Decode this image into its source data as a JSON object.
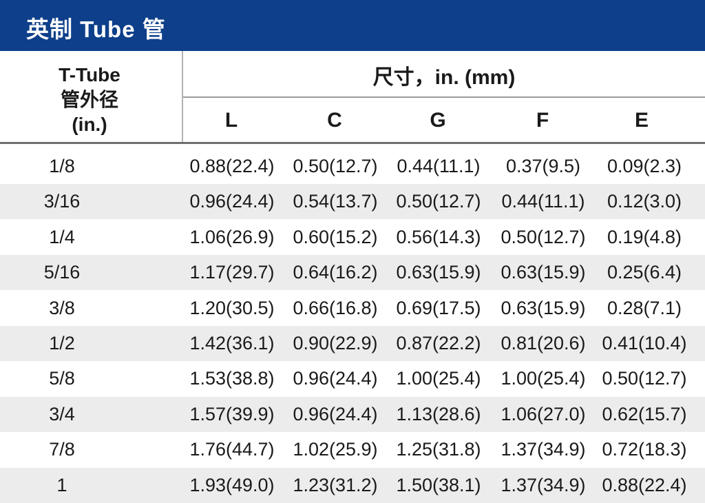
{
  "title": "英制 Tube 管",
  "header": {
    "tube_line1": "T-Tube",
    "tube_line2": "管外径",
    "tube_line3": "(in.)",
    "dimensions": "尺寸，in. (mm)"
  },
  "columns": [
    "L",
    "C",
    "G",
    "F",
    "E"
  ],
  "rows": [
    {
      "size": "1/8",
      "values": [
        "0.88(22.4)",
        "0.50(12.7)",
        "0.44(11.1)",
        "0.37(9.5)",
        "0.09(2.3)"
      ]
    },
    {
      "size": "3/16",
      "values": [
        "0.96(24.4)",
        "0.54(13.7)",
        "0.50(12.7)",
        "0.44(11.1)",
        "0.12(3.0)"
      ]
    },
    {
      "size": "1/4",
      "values": [
        "1.06(26.9)",
        "0.60(15.2)",
        "0.56(14.3)",
        "0.50(12.7)",
        "0.19(4.8)"
      ]
    },
    {
      "size": "5/16",
      "values": [
        "1.17(29.7)",
        "0.64(16.2)",
        "0.63(15.9)",
        "0.63(15.9)",
        "0.25(6.4)"
      ]
    },
    {
      "size": "3/8",
      "values": [
        "1.20(30.5)",
        "0.66(16.8)",
        "0.69(17.5)",
        "0.63(15.9)",
        "0.28(7.1)"
      ]
    },
    {
      "size": "1/2",
      "values": [
        "1.42(36.1)",
        "0.90(22.9)",
        "0.87(22.2)",
        "0.81(20.6)",
        "0.41(10.4)"
      ]
    },
    {
      "size": "5/8",
      "values": [
        "1.53(38.8)",
        "0.96(24.4)",
        "1.00(25.4)",
        "1.00(25.4)",
        "0.50(12.7)"
      ]
    },
    {
      "size": "3/4",
      "values": [
        "1.57(39.9)",
        "0.96(24.4)",
        "1.13(28.6)",
        "1.06(27.0)",
        "0.62(15.7)"
      ]
    },
    {
      "size": "7/8",
      "values": [
        "1.76(44.7)",
        "1.02(25.9)",
        "1.25(31.8)",
        "1.37(34.9)",
        "0.72(18.3)"
      ]
    },
    {
      "size": "1",
      "values": [
        "1.93(49.0)",
        "1.23(31.2)",
        "1.50(38.1)",
        "1.37(34.9)",
        "0.88(22.4)"
      ]
    }
  ],
  "colors": {
    "title_bar": "#0d3f8a",
    "title_text": "#ffffff",
    "row_shade": "#ececec"
  }
}
